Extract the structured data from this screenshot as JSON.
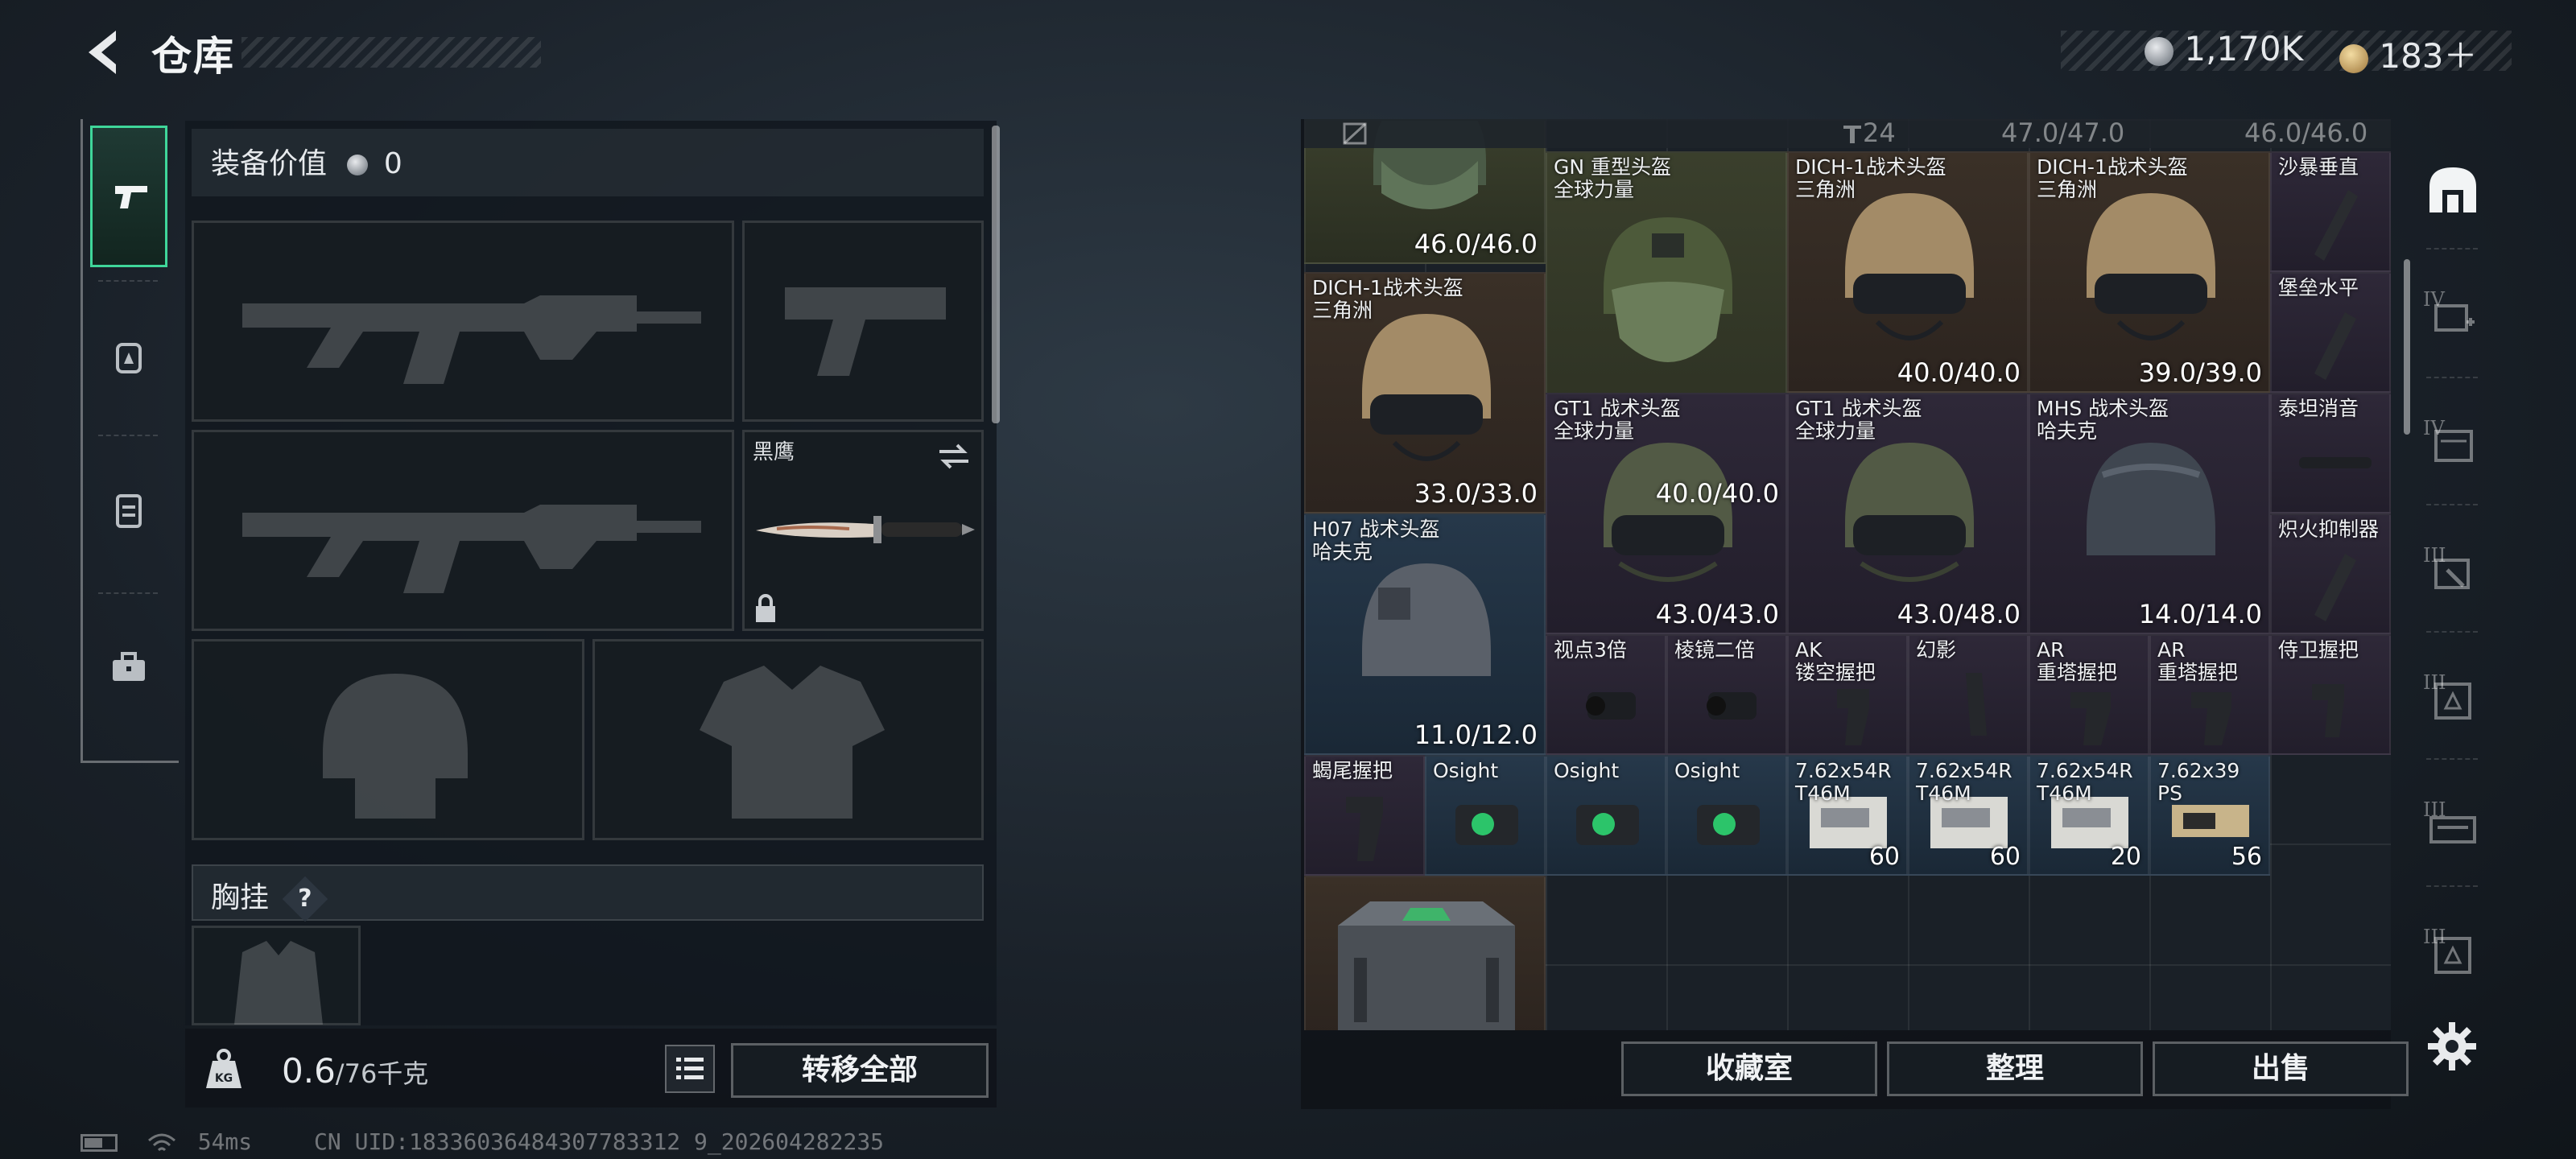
{
  "header": {
    "title": "仓库",
    "currency_silver": "1,170K",
    "currency_gold": "183＋"
  },
  "loadout": {
    "value_label": "装备价值",
    "value": "0",
    "knife_slot_label": "黑鹰",
    "chest_label": "胸挂",
    "chest_help": "?",
    "weight_value": "0.6",
    "weight_unit": "/76千克",
    "weight_icon_text": "KG",
    "transfer_all_label": "转移全部"
  },
  "storage": {
    "header_count": "24",
    "header_dur1": "47.0/47.0",
    "header_dur2": "46.0/46.0",
    "items": [
      {
        "name": "",
        "sub": "",
        "durability": "46.0/46.0"
      },
      {
        "name": "GN 重型头盔",
        "sub": "全球力量",
        "durability": "40.0/40.0"
      },
      {
        "name": "DICH-1战术头盔",
        "sub": "三角洲",
        "durability": "40.0/40.0"
      },
      {
        "name": "DICH-1战术头盔",
        "sub": "三角洲",
        "durability": "39.0/39.0"
      },
      {
        "name": "沙暴垂直",
        "sub": "",
        "durability": ""
      },
      {
        "name": "DICH-1战术头盔",
        "sub": "三角洲",
        "durability": "33.0/33.0"
      },
      {
        "name": "堡垒水平",
        "sub": "",
        "durability": ""
      },
      {
        "name": "GT1 战术头盔",
        "sub": "全球力量",
        "durability": "43.0/43.0"
      },
      {
        "name": "GT1 战术头盔",
        "sub": "全球力量",
        "durability": "43.0/48.0"
      },
      {
        "name": "MHS 战术头盔",
        "sub": "哈夫克",
        "durability": "14.0/14.0"
      },
      {
        "name": "泰坦消音",
        "sub": "",
        "durability": ""
      },
      {
        "name": "H07 战术头盔",
        "sub": "哈夫克",
        "durability": "11.0/12.0"
      },
      {
        "name": "炽火抑制器",
        "sub": "",
        "durability": ""
      },
      {
        "name": "视点3倍",
        "sub": "",
        "count": ""
      },
      {
        "name": "棱镜二倍",
        "sub": "",
        "count": ""
      },
      {
        "name": "AK",
        "sub": "镂空握把",
        "count": ""
      },
      {
        "name": "幻影",
        "sub": "",
        "count": ""
      },
      {
        "name": "AR",
        "sub": "重塔握把",
        "count": ""
      },
      {
        "name": "AR",
        "sub": "重塔握把",
        "count": ""
      },
      {
        "name": "侍卫握把",
        "sub": "",
        "count": ""
      },
      {
        "name": "蝎尾握把",
        "sub": "",
        "count": ""
      },
      {
        "name": "Osight",
        "sub": "",
        "count": ""
      },
      {
        "name": "Osight",
        "sub": "",
        "count": ""
      },
      {
        "name": "Osight",
        "sub": "",
        "count": ""
      },
      {
        "name": "7.62x54R",
        "sub": "T46M",
        "count": "60"
      },
      {
        "name": "7.62x54R",
        "sub": "T46M",
        "count": "60"
      },
      {
        "name": "7.62x54R",
        "sub": "T46M",
        "count": "20"
      },
      {
        "name": "7.62x39",
        "sub": "PS",
        "count": "56"
      }
    ],
    "buttons": {
      "collection": "收藏室",
      "organize": "整理",
      "sell": "出售"
    }
  },
  "right_categories": [
    "",
    "IV",
    "IV",
    "III",
    "III",
    "III",
    "III"
  ],
  "status": {
    "ping": "54ms",
    "uid": "CN UID:18336036484307783312 9_202604282235"
  },
  "colors": {
    "accent_green": "#3fd69a",
    "quality_brown": "#3a3027",
    "quality_purple": "#2e2838",
    "quality_blue": "#26384a"
  }
}
